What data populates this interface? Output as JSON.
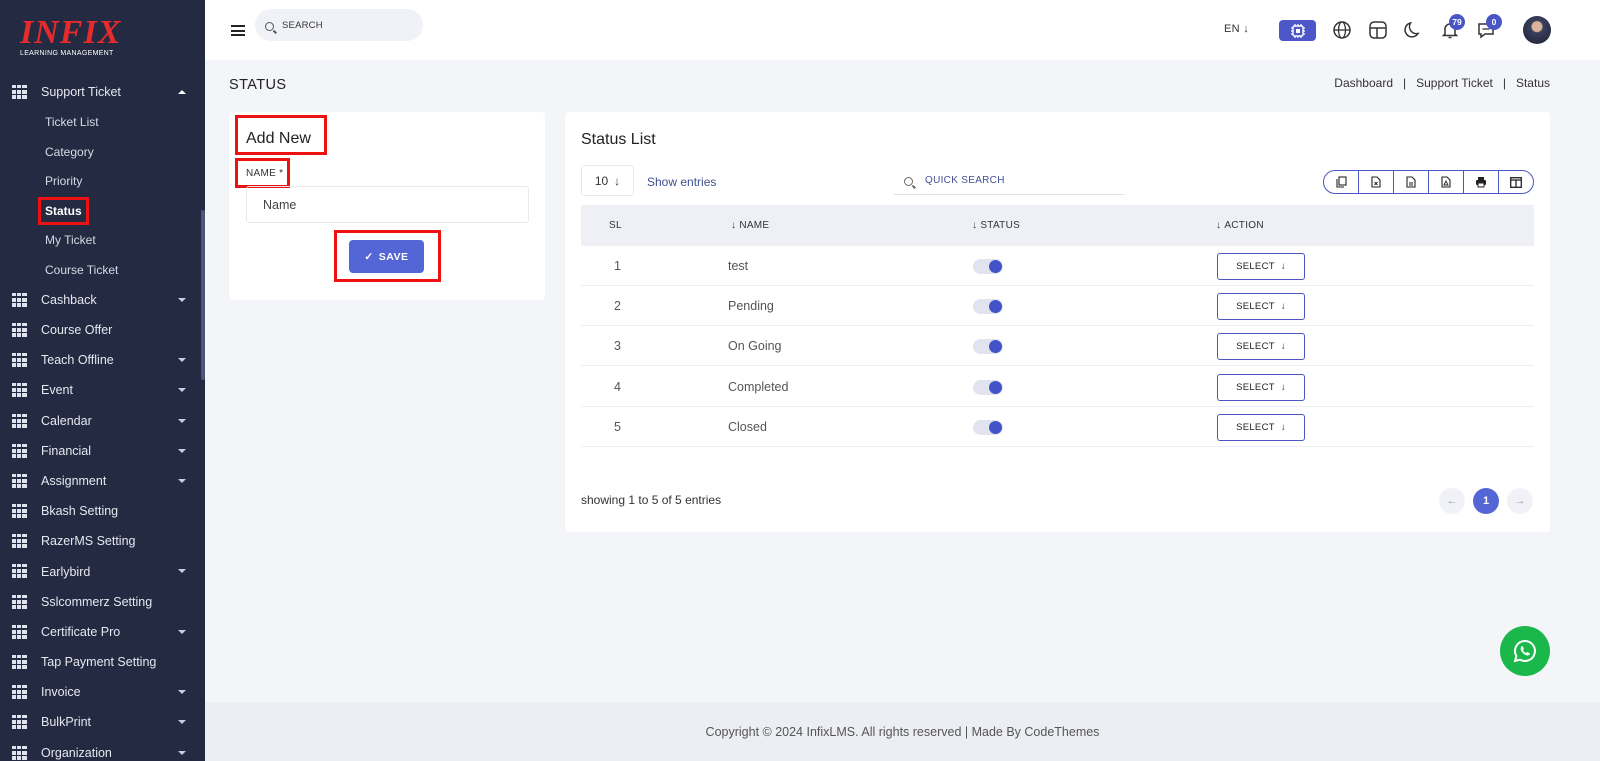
{
  "brand": {
    "logo_main": "INFIX",
    "logo_sub": "LEARNING MANAGEMENT",
    "logo_color": "#e52b2b"
  },
  "sidebar": {
    "menu_top": {
      "label": "Support Ticket",
      "icon": "grid-icon",
      "expanded": true
    },
    "subitems": [
      {
        "label": "Ticket List"
      },
      {
        "label": "Category"
      },
      {
        "label": "Priority"
      },
      {
        "label": "Status",
        "active": true
      },
      {
        "label": "My Ticket"
      },
      {
        "label": "Course Ticket"
      }
    ],
    "items": [
      {
        "label": "Cashback",
        "has_caret": true
      },
      {
        "label": "Course Offer",
        "has_caret": false
      },
      {
        "label": "Teach Offline",
        "has_caret": true
      },
      {
        "label": "Event",
        "has_caret": true
      },
      {
        "label": "Calendar",
        "has_caret": true
      },
      {
        "label": "Financial",
        "has_caret": true
      },
      {
        "label": "Assignment",
        "has_caret": true
      },
      {
        "label": "Bkash Setting",
        "has_caret": false
      },
      {
        "label": "RazerMS Setting",
        "has_caret": false
      },
      {
        "label": "Earlybird",
        "has_caret": true
      },
      {
        "label": "Sslcommerz Setting",
        "has_caret": false
      },
      {
        "label": "Certificate Pro",
        "has_caret": true
      },
      {
        "label": "Tap Payment Setting",
        "has_caret": false
      },
      {
        "label": "Invoice",
        "has_caret": true
      },
      {
        "label": "BulkPrint",
        "has_caret": true
      },
      {
        "label": "Organization",
        "has_caret": true
      }
    ]
  },
  "topbar": {
    "search_placeholder": "SEARCH",
    "language": "EN",
    "notifications_count": "79",
    "messages_count": "0",
    "accent": "#4b56c6"
  },
  "page": {
    "title": "STATUS",
    "breadcrumb": [
      "Dashboard",
      "Support Ticket",
      "Status"
    ]
  },
  "add_form": {
    "heading": "Add New",
    "name_label": "NAME *",
    "name_placeholder": "Name",
    "save_label": "SAVE"
  },
  "status_list": {
    "heading": "Status List",
    "page_size": "10",
    "show_entries": "Show entries",
    "quick_search": "QUICK SEARCH",
    "export_buttons": [
      "copy-icon",
      "excel-icon",
      "csv-icon",
      "pdf-icon",
      "print-icon",
      "columns-icon"
    ],
    "columns": [
      "SL",
      "NAME",
      "STATUS",
      "ACTION"
    ],
    "rows": [
      {
        "sl": "1",
        "name": "test",
        "status": true,
        "action": "SELECT"
      },
      {
        "sl": "2",
        "name": "Pending",
        "status": true,
        "action": "SELECT"
      },
      {
        "sl": "3",
        "name": "On Going",
        "status": true,
        "action": "SELECT"
      },
      {
        "sl": "4",
        "name": "Completed",
        "status": true,
        "action": "SELECT"
      },
      {
        "sl": "5",
        "name": "Closed",
        "status": true,
        "action": "SELECT"
      }
    ],
    "showing_text": "showing 1 to 5 of 5 entries",
    "current_page": "1"
  },
  "footer": {
    "text": "Copyright © 2024 InfixLMS. All rights reserved | Made By CodeThemes"
  }
}
